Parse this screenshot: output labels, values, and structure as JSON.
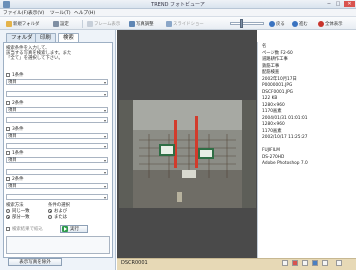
{
  "window": {
    "title": "TREND フォトビューア",
    "min": "−",
    "max": "□",
    "close": "✕"
  },
  "menu": [
    "ファイル(F)",
    "表示(V)",
    "ツール(T)",
    "ヘルプ(H)"
  ],
  "toolbar": {
    "new_folder": "新規フォルダ",
    "settings": "設定",
    "frame_prev": "フレーム表示",
    "photo_edit": "写真調整",
    "slideshow": "スライドショー",
    "back": "戻る",
    "forward": "進む",
    "fit": "全体表示"
  },
  "tabs": [
    "フォルダ",
    "印刷",
    "検索"
  ],
  "filter": {
    "desc_lines": [
      "検索条件を入力して、",
      "該当する写真を検索します。また",
      "「全て」を選択して下さい。"
    ],
    "cond1": "1条件",
    "cond2": "2条件",
    "cond3": "3条件",
    "item_label": "項目",
    "and_or_title": "検索方法",
    "and_label": "条件の選択",
    "opt_same": "同じ一致",
    "opt_part": "部分一致",
    "opt_and": "および",
    "opt_or": "または",
    "sub_cb": "検索結果で絞込",
    "exec": "実行",
    "show_orig": "表示写真を除外"
  },
  "status": {
    "filename": "DSCR0001"
  },
  "properties": [
    "名",
    "ページ数 F2-60",
    "道路耕作工事",
    "鉄筋工事",
    "配筋検査",
    "2002年10月17日",
    "P0000001.JPG",
    "DSCF0001.JPG",
    "122 KB",
    "1280×960",
    "1170画素",
    "2004/01/31 01:01:01",
    "1280×960",
    "1170画素",
    "2002/10/17 11:25:27",
    "",
    "FUJIFILM",
    "DS-270HD",
    "Adobe Photoshop 7.0"
  ]
}
